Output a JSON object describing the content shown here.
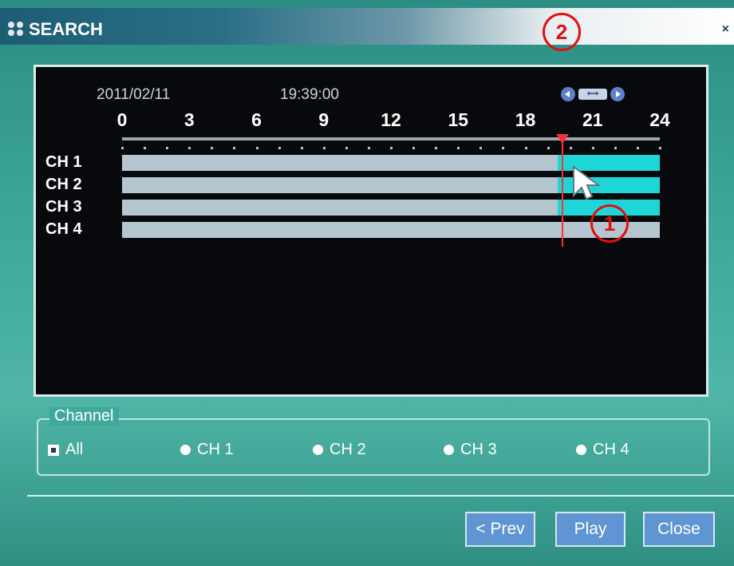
{
  "window": {
    "title": "SEARCH",
    "close_label": "×"
  },
  "markers": {
    "one": "1",
    "two": "2"
  },
  "timeline": {
    "date": "2011/02/11",
    "time": "19:39:00",
    "zoom_label": "⟷",
    "hours": [
      "0",
      "3",
      "6",
      "9",
      "12",
      "15",
      "18",
      "21",
      "24"
    ],
    "playhead_hour": 19.65,
    "channels": [
      {
        "label": "CH 1",
        "recording_hours": [
          [
            19.45,
            24
          ]
        ]
      },
      {
        "label": "CH 2",
        "recording_hours": [
          [
            19.45,
            24
          ]
        ]
      },
      {
        "label": "CH 3",
        "recording_hours": [
          [
            19.45,
            24
          ]
        ]
      },
      {
        "label": "CH 4",
        "recording_hours": []
      }
    ],
    "colors": {
      "track": "#b5c6d0",
      "recording": "#1ed6d6",
      "playhead": "#ff3030"
    }
  },
  "channel_group": {
    "title": "Channel",
    "options": [
      "All",
      "CH 1",
      "CH 2",
      "CH 3",
      "CH 4"
    ],
    "selected": "All"
  },
  "buttons": {
    "prev": "< Prev",
    "play": "Play",
    "close": "Close"
  }
}
